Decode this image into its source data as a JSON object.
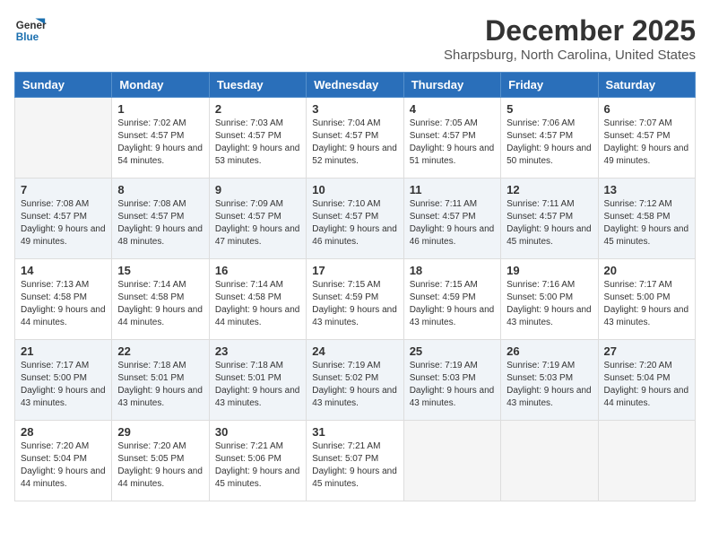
{
  "logo": {
    "line1": "General",
    "line2": "Blue"
  },
  "title": {
    "month_year": "December 2025",
    "location": "Sharpsburg, North Carolina, United States"
  },
  "weekdays": [
    "Sunday",
    "Monday",
    "Tuesday",
    "Wednesday",
    "Thursday",
    "Friday",
    "Saturday"
  ],
  "weeks": [
    [
      {
        "day": "",
        "sunrise": "",
        "sunset": "",
        "daylight": ""
      },
      {
        "day": "1",
        "sunrise": "Sunrise: 7:02 AM",
        "sunset": "Sunset: 4:57 PM",
        "daylight": "Daylight: 9 hours and 54 minutes."
      },
      {
        "day": "2",
        "sunrise": "Sunrise: 7:03 AM",
        "sunset": "Sunset: 4:57 PM",
        "daylight": "Daylight: 9 hours and 53 minutes."
      },
      {
        "day": "3",
        "sunrise": "Sunrise: 7:04 AM",
        "sunset": "Sunset: 4:57 PM",
        "daylight": "Daylight: 9 hours and 52 minutes."
      },
      {
        "day": "4",
        "sunrise": "Sunrise: 7:05 AM",
        "sunset": "Sunset: 4:57 PM",
        "daylight": "Daylight: 9 hours and 51 minutes."
      },
      {
        "day": "5",
        "sunrise": "Sunrise: 7:06 AM",
        "sunset": "Sunset: 4:57 PM",
        "daylight": "Daylight: 9 hours and 50 minutes."
      },
      {
        "day": "6",
        "sunrise": "Sunrise: 7:07 AM",
        "sunset": "Sunset: 4:57 PM",
        "daylight": "Daylight: 9 hours and 49 minutes."
      }
    ],
    [
      {
        "day": "7",
        "sunrise": "Sunrise: 7:08 AM",
        "sunset": "Sunset: 4:57 PM",
        "daylight": "Daylight: 9 hours and 49 minutes."
      },
      {
        "day": "8",
        "sunrise": "Sunrise: 7:08 AM",
        "sunset": "Sunset: 4:57 PM",
        "daylight": "Daylight: 9 hours and 48 minutes."
      },
      {
        "day": "9",
        "sunrise": "Sunrise: 7:09 AM",
        "sunset": "Sunset: 4:57 PM",
        "daylight": "Daylight: 9 hours and 47 minutes."
      },
      {
        "day": "10",
        "sunrise": "Sunrise: 7:10 AM",
        "sunset": "Sunset: 4:57 PM",
        "daylight": "Daylight: 9 hours and 46 minutes."
      },
      {
        "day": "11",
        "sunrise": "Sunrise: 7:11 AM",
        "sunset": "Sunset: 4:57 PM",
        "daylight": "Daylight: 9 hours and 46 minutes."
      },
      {
        "day": "12",
        "sunrise": "Sunrise: 7:11 AM",
        "sunset": "Sunset: 4:57 PM",
        "daylight": "Daylight: 9 hours and 45 minutes."
      },
      {
        "day": "13",
        "sunrise": "Sunrise: 7:12 AM",
        "sunset": "Sunset: 4:58 PM",
        "daylight": "Daylight: 9 hours and 45 minutes."
      }
    ],
    [
      {
        "day": "14",
        "sunrise": "Sunrise: 7:13 AM",
        "sunset": "Sunset: 4:58 PM",
        "daylight": "Daylight: 9 hours and 44 minutes."
      },
      {
        "day": "15",
        "sunrise": "Sunrise: 7:14 AM",
        "sunset": "Sunset: 4:58 PM",
        "daylight": "Daylight: 9 hours and 44 minutes."
      },
      {
        "day": "16",
        "sunrise": "Sunrise: 7:14 AM",
        "sunset": "Sunset: 4:58 PM",
        "daylight": "Daylight: 9 hours and 44 minutes."
      },
      {
        "day": "17",
        "sunrise": "Sunrise: 7:15 AM",
        "sunset": "Sunset: 4:59 PM",
        "daylight": "Daylight: 9 hours and 43 minutes."
      },
      {
        "day": "18",
        "sunrise": "Sunrise: 7:15 AM",
        "sunset": "Sunset: 4:59 PM",
        "daylight": "Daylight: 9 hours and 43 minutes."
      },
      {
        "day": "19",
        "sunrise": "Sunrise: 7:16 AM",
        "sunset": "Sunset: 5:00 PM",
        "daylight": "Daylight: 9 hours and 43 minutes."
      },
      {
        "day": "20",
        "sunrise": "Sunrise: 7:17 AM",
        "sunset": "Sunset: 5:00 PM",
        "daylight": "Daylight: 9 hours and 43 minutes."
      }
    ],
    [
      {
        "day": "21",
        "sunrise": "Sunrise: 7:17 AM",
        "sunset": "Sunset: 5:00 PM",
        "daylight": "Daylight: 9 hours and 43 minutes."
      },
      {
        "day": "22",
        "sunrise": "Sunrise: 7:18 AM",
        "sunset": "Sunset: 5:01 PM",
        "daylight": "Daylight: 9 hours and 43 minutes."
      },
      {
        "day": "23",
        "sunrise": "Sunrise: 7:18 AM",
        "sunset": "Sunset: 5:01 PM",
        "daylight": "Daylight: 9 hours and 43 minutes."
      },
      {
        "day": "24",
        "sunrise": "Sunrise: 7:19 AM",
        "sunset": "Sunset: 5:02 PM",
        "daylight": "Daylight: 9 hours and 43 minutes."
      },
      {
        "day": "25",
        "sunrise": "Sunrise: 7:19 AM",
        "sunset": "Sunset: 5:03 PM",
        "daylight": "Daylight: 9 hours and 43 minutes."
      },
      {
        "day": "26",
        "sunrise": "Sunrise: 7:19 AM",
        "sunset": "Sunset: 5:03 PM",
        "daylight": "Daylight: 9 hours and 43 minutes."
      },
      {
        "day": "27",
        "sunrise": "Sunrise: 7:20 AM",
        "sunset": "Sunset: 5:04 PM",
        "daylight": "Daylight: 9 hours and 44 minutes."
      }
    ],
    [
      {
        "day": "28",
        "sunrise": "Sunrise: 7:20 AM",
        "sunset": "Sunset: 5:04 PM",
        "daylight": "Daylight: 9 hours and 44 minutes."
      },
      {
        "day": "29",
        "sunrise": "Sunrise: 7:20 AM",
        "sunset": "Sunset: 5:05 PM",
        "daylight": "Daylight: 9 hours and 44 minutes."
      },
      {
        "day": "30",
        "sunrise": "Sunrise: 7:21 AM",
        "sunset": "Sunset: 5:06 PM",
        "daylight": "Daylight: 9 hours and 45 minutes."
      },
      {
        "day": "31",
        "sunrise": "Sunrise: 7:21 AM",
        "sunset": "Sunset: 5:07 PM",
        "daylight": "Daylight: 9 hours and 45 minutes."
      },
      {
        "day": "",
        "sunrise": "",
        "sunset": "",
        "daylight": ""
      },
      {
        "day": "",
        "sunrise": "",
        "sunset": "",
        "daylight": ""
      },
      {
        "day": "",
        "sunrise": "",
        "sunset": "",
        "daylight": ""
      }
    ]
  ]
}
